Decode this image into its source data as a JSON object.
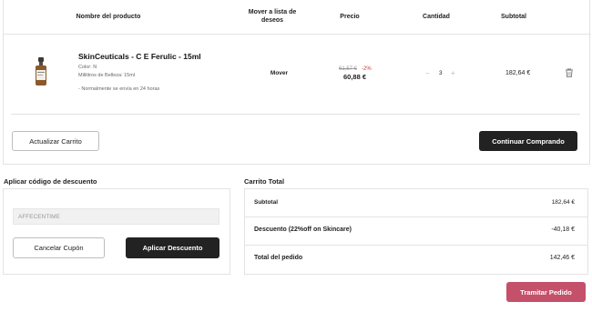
{
  "cart": {
    "headers": {
      "product": "Nombre del producto",
      "wishlist_line1": "Mover a lista de",
      "wishlist_line2": "deseos",
      "price": "Precio",
      "quantity": "Cantidad",
      "subtotal": "Subtotal"
    },
    "item": {
      "name": "SkinCeuticals - C E Ferulic - 15ml",
      "color": "Color: N",
      "size": "Mililitros de Belleza: 15ml",
      "shipping": "- Normalmente se envía en 24 horas",
      "move_label": "Mover",
      "old_price": "61,57 €",
      "discount": "-2%",
      "price": "60,88 €",
      "qty_minus": "−",
      "quantity": "3",
      "qty_plus": "+",
      "subtotal": "182,64 €",
      "icon": "trash-icon"
    },
    "update_button": "Actualizar Carrito",
    "continue_button": "Continuar Comprando"
  },
  "coupon": {
    "title": "Aplicar código de descuento",
    "code": "AFFECENTIME",
    "cancel_button": "Cancelar Cupón",
    "apply_button": "Aplicar Descuento"
  },
  "totals": {
    "title": "Carrito Total",
    "subtotal_label": "Subtotal",
    "subtotal_value": "182,64 €",
    "discount_label": "Descuento (22%off on Skincare)",
    "discount_value": "-40,18 €",
    "total_label": "Total del pedido",
    "total_value": "142,46 €"
  },
  "checkout_button": "Tramitar Pedido",
  "colors": {
    "primary_dark": "#222222",
    "checkout_accent": "#c4506a",
    "discount_red": "#d4343c"
  }
}
